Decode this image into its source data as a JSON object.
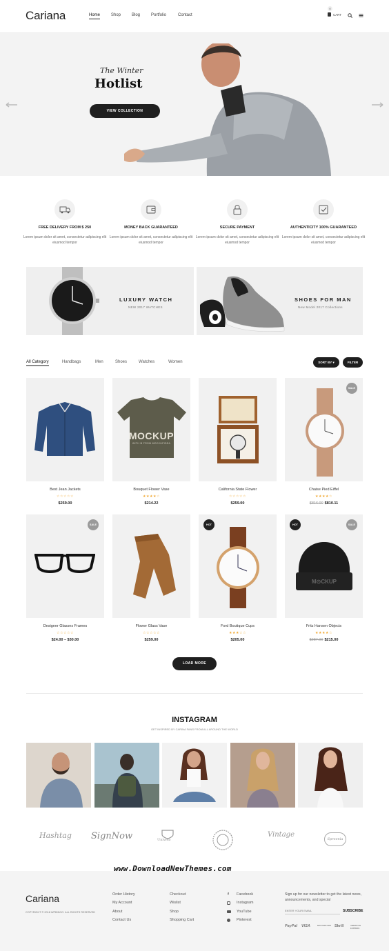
{
  "header": {
    "logo": "Cariana",
    "nav": [
      "Home",
      "Shop",
      "Blog",
      "Portfolio",
      "Contact"
    ],
    "cart_label": "CART",
    "cart_count": "0"
  },
  "hero": {
    "subtitle": "The Winter",
    "title": "Hotlist",
    "button": "VIEW COLLECTION"
  },
  "features": [
    {
      "title": "FREE DELIVERY FROM $ 250",
      "text": "Lorem ipsum dolor sit amet, consectetur adipiscing elit eiusmod tempor",
      "icon": "truck-icon"
    },
    {
      "title": "MONEY BACK GUARANTEED",
      "text": "Lorem ipsum dolor sit amet, consectetur adipiscing elit eiusmod tempor",
      "icon": "wallet-icon"
    },
    {
      "title": "SECURE PAYMENT",
      "text": "Lorem ipsum dolor sit amet, consectetur adipiscing elit eiusmod tempor",
      "icon": "lock-icon"
    },
    {
      "title": "AUTHENTICITY 100% GUARANTEED",
      "text": "Lorem ipsum dolor sit amet, consectetur adipiscing elit eiusmod tempor",
      "icon": "check-icon"
    }
  ],
  "banners": [
    {
      "title": "LUXURY WATCH",
      "subtitle": "NEW 2017 WATCHES"
    },
    {
      "title": "SHOES FOR MAN",
      "subtitle": "New Model 2017 Collections"
    }
  ],
  "filters": {
    "categories": [
      "All Category",
      "Handbags",
      "Men",
      "Shoes",
      "Watches",
      "Women"
    ],
    "sort": "SORT BY ▾",
    "filter": "FILTER"
  },
  "products": [
    {
      "name": "Best Jean Jackets",
      "rating": "☆☆☆☆☆",
      "price": "$259.00",
      "old": ""
    },
    {
      "name": "Bouquet Flower Vase",
      "rating": "★★★★☆",
      "price": "$214.22",
      "old": ""
    },
    {
      "name": "California State Flower",
      "rating": "☆☆☆☆☆",
      "price": "$259.00",
      "old": ""
    },
    {
      "name": "Chaise Pied Eiffel",
      "rating": "★★★★☆",
      "price": "$810.11",
      "old": "$816.00",
      "badge": "SALE"
    },
    {
      "name": "Designer Glasses Frames",
      "rating": "☆☆☆☆☆",
      "price": "$24.00 – $30.00",
      "old": "",
      "badge": "SALE"
    },
    {
      "name": "Flower Glass Vase",
      "rating": "☆☆☆☆☆",
      "price": "$259.00",
      "old": ""
    },
    {
      "name": "Ford Boutique Cups",
      "rating": "★★★☆☆",
      "price": "$205.00",
      "old": "",
      "badge": "HOT"
    },
    {
      "name": "Fritz Hansen Objects",
      "rating": "★★★★☆",
      "price": "$215.00",
      "old": "$287.00",
      "badge": "HOT",
      "badge2": "SALE"
    }
  ],
  "mockup_text": "MOCKUP",
  "mockup_sub": "WITH ❤ FROM MOCKUPIDEA",
  "load_more": "LOAD MORE",
  "instagram": {
    "title": "INSTAGRAM",
    "subtitle": "GET INSPIRED BY CARINA FANS FROM ALL AROUND THE WORLD"
  },
  "brands": [
    "Hashtag",
    "SignNow",
    "Uniweb",
    "Legacy",
    "Vintage",
    "Spreenia"
  ],
  "watermark": "www.DownloadNewThemes.com",
  "footer": {
    "logo": "Cariana",
    "copyright": "COPYRIGHT © 2018 WPBINGO. ALL RIGHTS RESERVED",
    "col1": [
      "Order History",
      "My Account",
      "About",
      "Contact Us"
    ],
    "col2": [
      "Checkout",
      "Wislist",
      "Shop",
      "Shopping Cart"
    ],
    "social": [
      "Facebook",
      "Instagram",
      "YouTube",
      "Pinterest"
    ],
    "newsletter_text": "Sign up for our newsletter to get the latest news, announcements, and special",
    "email_placeholder": "ENTER YOUR EMAIL",
    "subscribe": "SUBSCRIBE",
    "payments": [
      "PayPal",
      "VISA",
      "MASTERCARD",
      "Skrill",
      "AMERICAN EXPRESS"
    ]
  },
  "colors": {
    "dark": "#1f1f1f",
    "star": "#f0a830",
    "hot": "#222222",
    "sale": "#9a9a9a"
  }
}
